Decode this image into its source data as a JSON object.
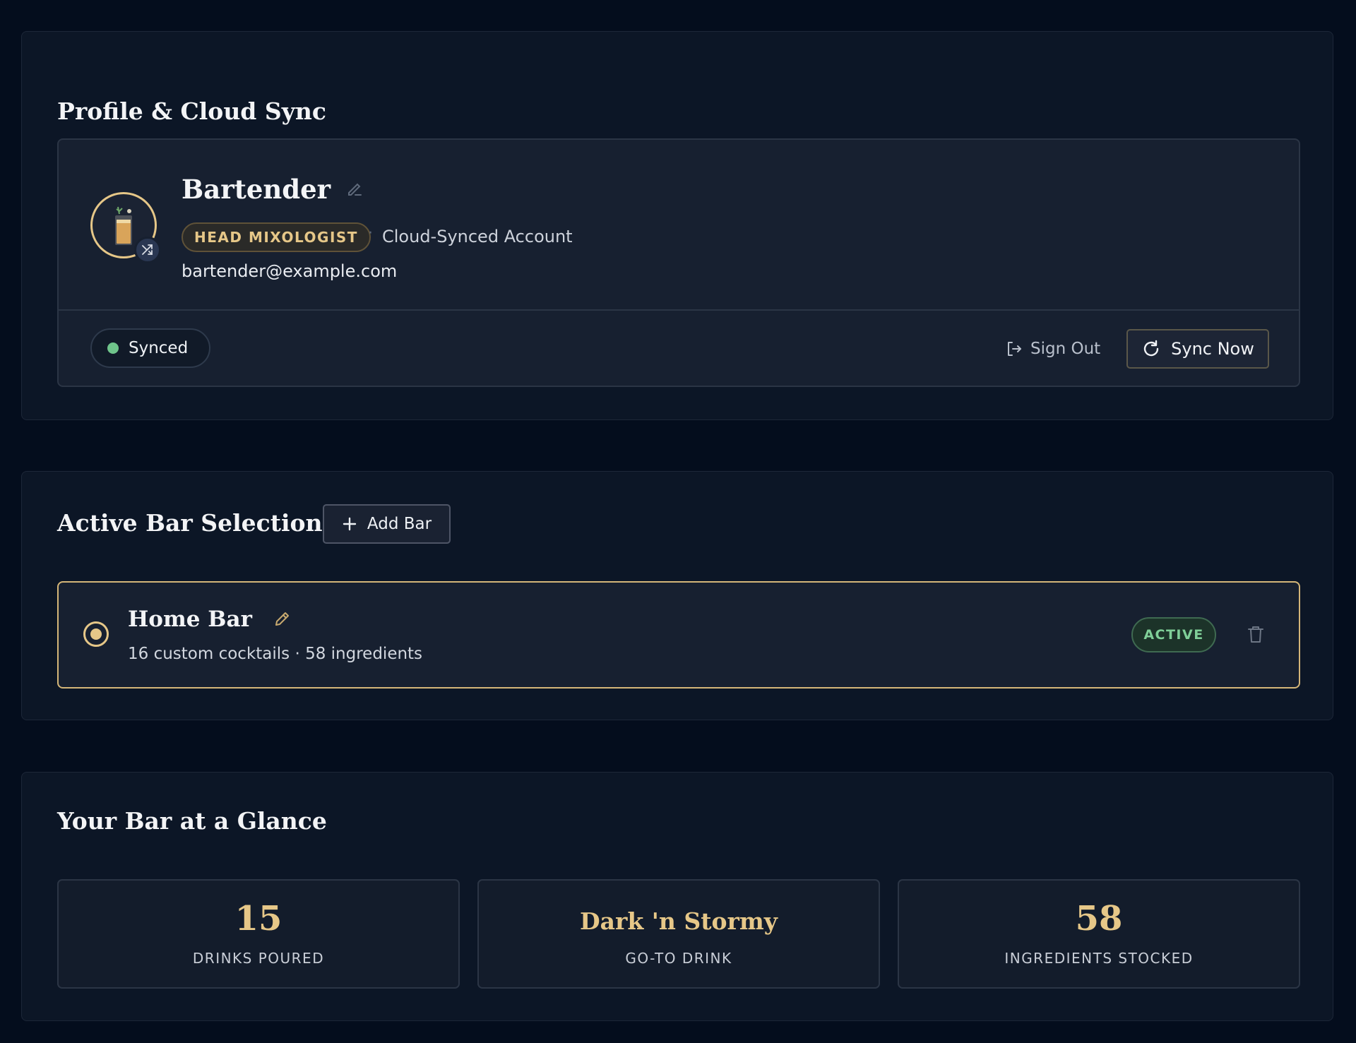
{
  "profile_section": {
    "title": "Profile & Cloud Sync",
    "name": "Bartender",
    "role_badge": "HEAD MIXOLOGIST",
    "separator": "·",
    "account_type": "Cloud-Synced Account",
    "email": "bartender@example.com",
    "sync_status": "Synced",
    "sign_out_label": "Sign Out",
    "sync_now_label": "Sync Now"
  },
  "bar_section": {
    "title": "Active Bar Selection",
    "add_bar_label": "Add Bar",
    "bars": [
      {
        "name": "Home Bar",
        "meta": "16 custom cocktails · 58 ingredients",
        "status_badge": "ACTIVE"
      }
    ]
  },
  "glance_section": {
    "title": "Your Bar at a Glance",
    "stats": [
      {
        "value": "15",
        "label": "DRINKS POURED"
      },
      {
        "value": "Dark 'n Stormy",
        "label": "GO-TO DRINK"
      },
      {
        "value": "58",
        "label": "INGREDIENTS STOCKED"
      }
    ]
  },
  "colors": {
    "background": "#040d1d",
    "panel": "#0c1626",
    "accent_gold": "#e6c788",
    "status_green": "#6fc48b"
  },
  "icons": [
    "cocktail-glass-icon",
    "sync-shuffle-icon",
    "pencil-icon",
    "sign-out-icon",
    "refresh-icon",
    "plus-icon",
    "trash-icon"
  ]
}
